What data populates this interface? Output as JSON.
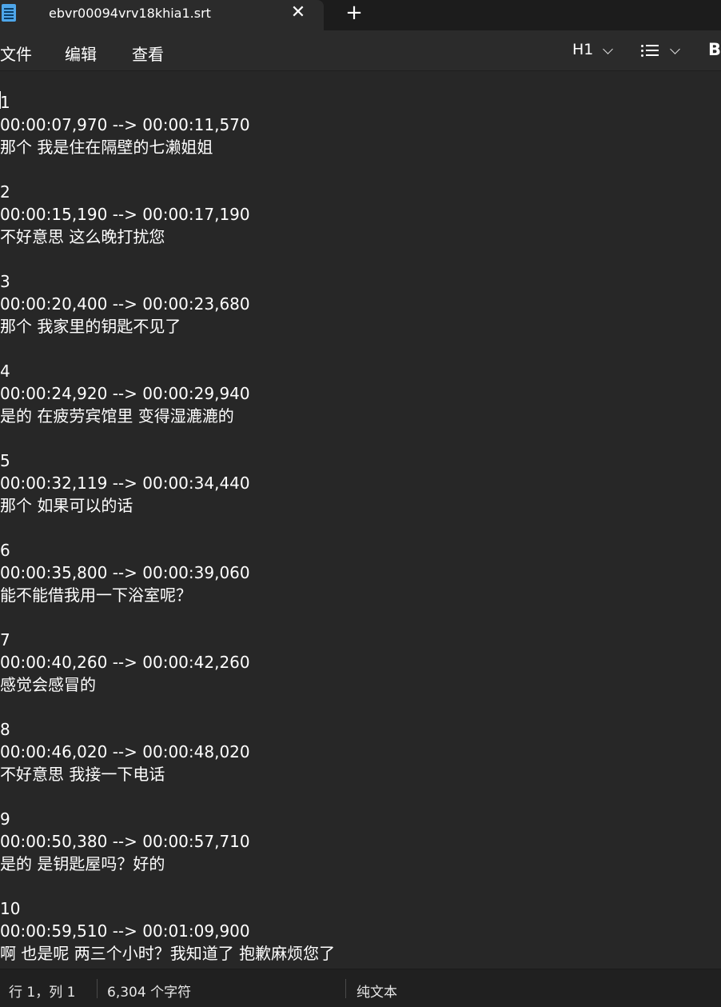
{
  "tab": {
    "title": "ebvr00094vrv18khia1.srt",
    "close_glyph": "✕",
    "new_tab_glyph": "+"
  },
  "menu": {
    "file": "文件",
    "edit": "编辑",
    "view": "查看"
  },
  "toolbar": {
    "heading_label": "H1",
    "bold_label": "B"
  },
  "editor": {
    "lines": [
      "1",
      "00:00:07,970 --> 00:00:11,570",
      "那个 我是住在隔壁的七濑姐姐",
      "",
      "2",
      "00:00:15,190 --> 00:00:17,190",
      "不好意思 这么晚打扰您",
      "",
      "3",
      "00:00:20,400 --> 00:00:23,680",
      "那个 我家里的钥匙不见了",
      "",
      "4",
      "00:00:24,920 --> 00:00:29,940",
      "是的 在疲劳宾馆里 变得湿漉漉的",
      "",
      "5",
      "00:00:32,119 --> 00:00:34,440",
      "那个 如果可以的话",
      "",
      "6",
      "00:00:35,800 --> 00:00:39,060",
      "能不能借我用一下浴室呢？",
      "",
      "7",
      "00:00:40,260 --> 00:00:42,260",
      "感觉会感冒的",
      "",
      "8",
      "00:00:46,020 --> 00:00:48,020",
      "不好意思 我接一下电话",
      "",
      "9",
      "00:00:50,380 --> 00:00:57,710",
      "是的 是钥匙屋吗？好的",
      "",
      "10",
      "00:00:59,510 --> 00:01:09,900",
      "啊 也是呢 两三个小时？我知道了 抱歉麻烦您了"
    ]
  },
  "status": {
    "position": "行 1，列 1",
    "char_count": "6,304 个字符",
    "format": "纯文本"
  },
  "colors": {
    "background": "#272727",
    "titlebar": "#1c1c1c",
    "statusbar": "#202020",
    "app_icon": "#4ea6ea"
  }
}
